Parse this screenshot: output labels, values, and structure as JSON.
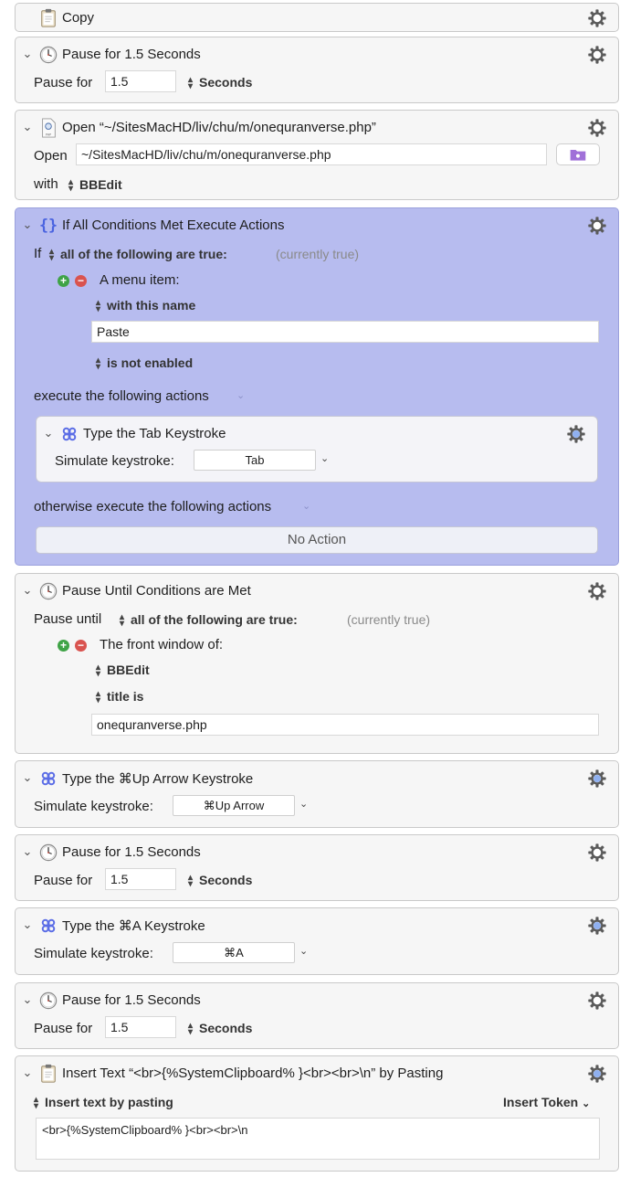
{
  "actions": {
    "copy": {
      "title": "Copy"
    },
    "pause1": {
      "title": "Pause for 1.5 Seconds",
      "label": "Pause for",
      "value": "1.5",
      "unit": "Seconds"
    },
    "open": {
      "title": "Open “~/SitesMacHD/liv/chu/m/onequranverse.php”",
      "open_label": "Open",
      "path": "~/SitesMacHD/liv/chu/m/onequranverse.php",
      "with_label": "with",
      "app": "BBEdit"
    },
    "if": {
      "title": "If All Conditions Met Execute Actions",
      "if_label": "If",
      "condition_mode": "all of the following are true:",
      "status": "(currently true)",
      "condition_type": "A menu item:",
      "match_mode": "with this name",
      "menu_name": "Paste",
      "state": "is not enabled",
      "execute_label": "execute the following actions",
      "otherwise_label": "otherwise execute the following actions",
      "no_action": "No Action",
      "nested": {
        "title": "Type the Tab Keystroke",
        "label": "Simulate keystroke:",
        "key": "Tab"
      }
    },
    "pauseUntil": {
      "title": "Pause Until Conditions are Met",
      "label": "Pause until",
      "condition_mode": "all of the following are true:",
      "status": "(currently true)",
      "condition_type": "The front window of:",
      "app": "BBEdit",
      "match_mode": "title is",
      "title_value": "onequranverse.php"
    },
    "typeUp": {
      "title": "Type the ⌘Up Arrow Keystroke",
      "label": "Simulate keystroke:",
      "key": "⌘Up Arrow"
    },
    "pause2": {
      "title": "Pause for 1.5 Seconds",
      "label": "Pause for",
      "value": "1.5",
      "unit": "Seconds"
    },
    "typeA": {
      "title": "Type the ⌘A Keystroke",
      "label": "Simulate keystroke:",
      "key": "⌘A"
    },
    "pause3": {
      "title": "Pause for 1.5 Seconds",
      "label": "Pause for",
      "value": "1.5",
      "unit": "Seconds"
    },
    "insert": {
      "title": "Insert Text “<br>{%SystemClipboard% }<br><br>\\n” by Pasting",
      "mode": "Insert text by pasting",
      "token_label": "Insert Token",
      "text": "<br>{%SystemClipboard% }<br><br>\\n"
    }
  },
  "icons": {
    "chevron": "chevron-down-icon",
    "gear": "gear-icon",
    "clock": "clock-icon",
    "command": "command-key-icon",
    "clipboard": "clipboard-icon",
    "braces": "braces-icon",
    "document": "document-icon",
    "folder": "folder-icon"
  },
  "colors": {
    "selected_bg": "#b7bcef",
    "command_icon": "#5b6de6",
    "gear_accent": "#3a63d8"
  }
}
